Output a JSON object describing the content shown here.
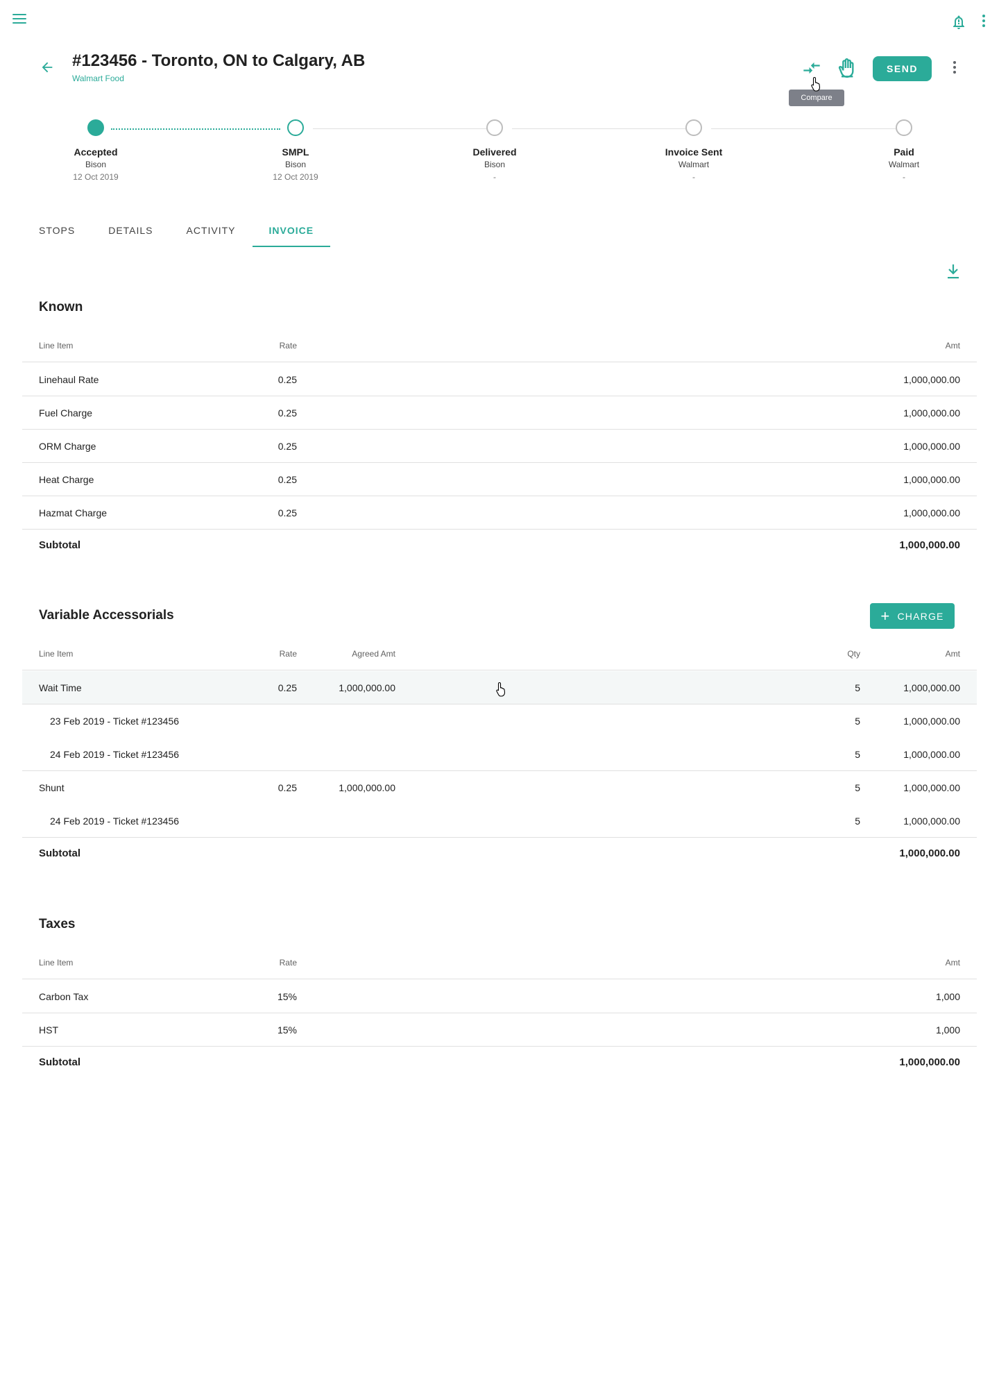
{
  "app": {
    "header": {
      "title": "#123456 - Toronto, ON to Calgary, AB",
      "subtitle": "Walmart Food",
      "send_label": "SEND",
      "tooltip": "Compare"
    },
    "icons": [
      "menu-icon",
      "notification-bell-icon",
      "more-vert-icon",
      "back-arrow-icon",
      "compare-icon",
      "hand-icon",
      "download-icon",
      "plus-icon"
    ],
    "accent_color": "#2bab99"
  },
  "stepper": [
    {
      "label": "Accepted",
      "party": "Bison",
      "date": "12 Oct 2019",
      "state": "done"
    },
    {
      "label": "SMPL",
      "party": "Bison",
      "date": "12 Oct 2019",
      "state": "current"
    },
    {
      "label": "Delivered",
      "party": "Bison",
      "date": "-",
      "state": "todo"
    },
    {
      "label": "Invoice Sent",
      "party": "Walmart",
      "date": "-",
      "state": "todo"
    },
    {
      "label": "Paid",
      "party": "Walmart",
      "date": "-",
      "state": "todo"
    }
  ],
  "tabs": [
    {
      "label": "STOPS",
      "active": false
    },
    {
      "label": "DETAILS",
      "active": false
    },
    {
      "label": "ACTIVITY",
      "active": false
    },
    {
      "label": "INVOICE",
      "active": true
    }
  ],
  "known": {
    "title": "Known",
    "columns": {
      "item": "Line Item",
      "rate": "Rate",
      "amt": "Amt"
    },
    "rows": [
      {
        "item": "Linehaul Rate",
        "rate": "0.25",
        "amt": "1,000,000.00"
      },
      {
        "item": "Fuel Charge",
        "rate": "0.25",
        "amt": "1,000,000.00"
      },
      {
        "item": "ORM Charge",
        "rate": "0.25",
        "amt": "1,000,000.00"
      },
      {
        "item": "Heat Charge",
        "rate": "0.25",
        "amt": "1,000,000.00"
      },
      {
        "item": "Hazmat Charge",
        "rate": "0.25",
        "amt": "1,000,000.00"
      }
    ],
    "subtotal_label": "Subtotal",
    "subtotal": "1,000,000.00"
  },
  "variable": {
    "title": "Variable Accessorials",
    "add_label": "CHARGE",
    "columns": {
      "item": "Line Item",
      "rate": "Rate",
      "agreed": "Agreed Amt",
      "qty": "Qty",
      "amt": "Amt"
    },
    "rows": [
      {
        "item": "Wait Time",
        "rate": "0.25",
        "agreed": "1,000,000.00",
        "qty": "5",
        "amt": "1,000,000.00"
      },
      {
        "item": "23 Feb 2019 - Ticket #123456",
        "qty": "5",
        "amt": "1,000,000.00"
      },
      {
        "item": "24 Feb 2019 - Ticket #123456",
        "qty": "5",
        "amt": "1,000,000.00"
      },
      {
        "item": "Shunt",
        "rate": "0.25",
        "agreed": "1,000,000.00",
        "qty": "5",
        "amt": "1,000,000.00"
      },
      {
        "item": "24 Feb 2019 - Ticket #123456",
        "qty": "5",
        "amt": "1,000,000.00"
      }
    ],
    "subtotal_label": "Subtotal",
    "subtotal": "1,000,000.00"
  },
  "taxes": {
    "title": "Taxes",
    "columns": {
      "item": "Line Item",
      "rate": "Rate",
      "amt": "Amt"
    },
    "rows": [
      {
        "item": "Carbon Tax",
        "rate": "15%",
        "amt": "1,000"
      },
      {
        "item": "HST",
        "rate": "15%",
        "amt": "1,000"
      }
    ],
    "subtotal_label": "Subtotal",
    "subtotal": "1,000,000.00"
  }
}
